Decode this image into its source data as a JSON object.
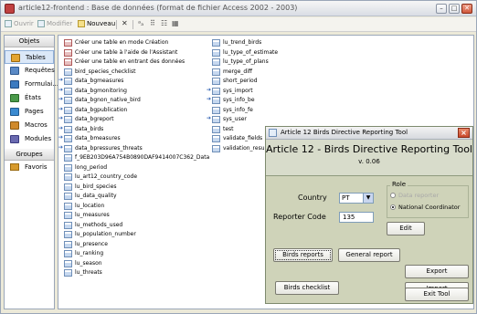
{
  "window": {
    "title": "article12-frontend : Base de données (format de fichier Access 2002 - 2003)",
    "minimize": "–",
    "maximize": "□",
    "close": "✕"
  },
  "toolbar": {
    "open": "Ouvrir",
    "modify": "Modifier",
    "new": "Nouveau",
    "delete_icon": "✕",
    "icons": [
      "ᵃₐ",
      "⠿",
      "☷",
      "▦"
    ]
  },
  "objects_pane": {
    "header": "Objets",
    "items": [
      {
        "label": "Tables",
        "icon": "tables-icon",
        "color": "#e3a531"
      },
      {
        "label": "Requêtes",
        "icon": "queries-icon",
        "color": "#5a8ac6"
      },
      {
        "label": "Formulai...",
        "icon": "forms-icon",
        "color": "#3b7ac0"
      },
      {
        "label": "États",
        "icon": "reports-icon",
        "color": "#4a9a4a"
      },
      {
        "label": "Pages",
        "icon": "pages-icon",
        "color": "#3a8ad0"
      },
      {
        "label": "Macros",
        "icon": "macros-icon",
        "color": "#d08a2a"
      },
      {
        "label": "Modules",
        "icon": "modules-icon",
        "color": "#6a6ab0"
      }
    ],
    "groups_header": "Groupes",
    "favorites": "Favoris"
  },
  "tables_list": {
    "col1": [
      {
        "name": "Créer une table en mode Création",
        "kind": "wiz"
      },
      {
        "name": "Créer une table à l'aide de l'Assistant",
        "kind": "wiz"
      },
      {
        "name": "Créer une table en entrant des données",
        "kind": "wiz"
      },
      {
        "name": "bird_species_checklist",
        "kind": "table"
      },
      {
        "name": "data_bgmeasures",
        "kind": "link"
      },
      {
        "name": "data_bgmonitoring",
        "kind": "link"
      },
      {
        "name": "data_bgnon_native_bird",
        "kind": "link"
      },
      {
        "name": "data_bgpublication",
        "kind": "link"
      },
      {
        "name": "data_bgreport",
        "kind": "link"
      },
      {
        "name": "data_birds",
        "kind": "link"
      },
      {
        "name": "data_bmeasures",
        "kind": "link"
      },
      {
        "name": "data_bpressures_threats",
        "kind": "link"
      },
      {
        "name": "f_9EB203D96A754B0890DAF9414007C362_Data",
        "kind": "table"
      },
      {
        "name": "long_period",
        "kind": "table"
      },
      {
        "name": "lu_art12_country_code",
        "kind": "table"
      },
      {
        "name": "lu_bird_species",
        "kind": "table"
      },
      {
        "name": "lu_data_quality",
        "kind": "table"
      },
      {
        "name": "lu_location",
        "kind": "table"
      },
      {
        "name": "lu_measures",
        "kind": "table"
      },
      {
        "name": "lu_methods_used",
        "kind": "table"
      },
      {
        "name": "lu_population_number",
        "kind": "table"
      },
      {
        "name": "lu_presence",
        "kind": "table"
      },
      {
        "name": "lu_ranking",
        "kind": "table"
      },
      {
        "name": "lu_season",
        "kind": "table"
      },
      {
        "name": "lu_threats",
        "kind": "table"
      }
    ],
    "col2": [
      {
        "name": "lu_trend_birds",
        "kind": "table"
      },
      {
        "name": "lu_type_of_estimate",
        "kind": "table"
      },
      {
        "name": "lu_type_of_plans",
        "kind": "table"
      },
      {
        "name": "merge_diff",
        "kind": "table"
      },
      {
        "name": "short_period",
        "kind": "table"
      },
      {
        "name": "sys_import",
        "kind": "link"
      },
      {
        "name": "sys_info_be",
        "kind": "link"
      },
      {
        "name": "sys_info_fe",
        "kind": "table"
      },
      {
        "name": "sys_user",
        "kind": "link"
      },
      {
        "name": "test",
        "kind": "table"
      },
      {
        "name": "validate_fields",
        "kind": "table"
      },
      {
        "name": "validation_result",
        "kind": "table"
      }
    ]
  },
  "dialog": {
    "title": "Article 12 Birds Directive Reporting Tool",
    "heading": "Article 12 - Birds Directive Reporting Tool",
    "version": "v.  0.06",
    "country_label": "Country",
    "country_value": "PT",
    "reporter_label": "Reporter Code",
    "reporter_value": "135",
    "role_legend": "Role",
    "role_options": [
      {
        "label": "Data reporter",
        "selected": false,
        "enabled": false
      },
      {
        "label": "National Coordinator",
        "selected": true,
        "enabled": true
      }
    ],
    "edit_button": "Edit",
    "birds_reports_button": "Birds reports",
    "general_report_button": "General report",
    "birds_checklist_button": "Birds checklist",
    "import_button": "Import",
    "export_button": "Export",
    "exit_button": "Exit Tool"
  }
}
